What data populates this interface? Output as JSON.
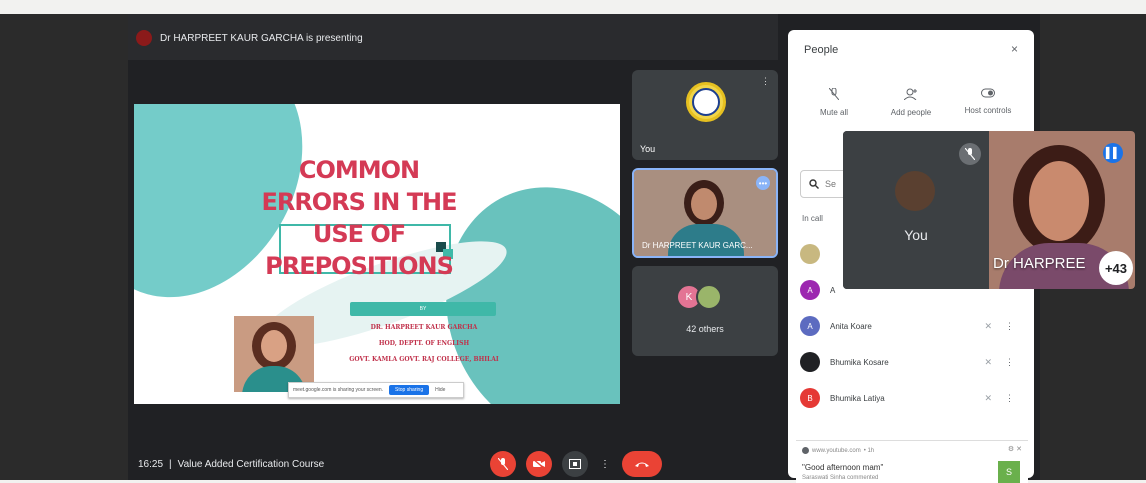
{
  "presenter": {
    "avatar_initial": "",
    "text": "Dr HARPREET KAUR GARCHA is presenting"
  },
  "slide": {
    "title": "COMMON ERRORS IN THE USE OF PREPOSITIONS",
    "band_text": "BY",
    "lines": [
      "DR. HARPREET KAUR GARCHA",
      "HOD, DEPTT. OF ENGLISH",
      "GOVT. KAMLA GOVT. RAJ COLLEGE, BHILAI"
    ],
    "share_notice": "meet.google.com is sharing your screen.",
    "share_stop": "Stop sharing",
    "share_hide": "Hide"
  },
  "tiles": {
    "you_label": "You",
    "harpreet_label": "Dr HARPREET KAUR GARC...",
    "others_label": "42 others",
    "others_initial": "K"
  },
  "bottom": {
    "time": "16:25",
    "separator": "|",
    "meeting_title": "Value Added Certification Course"
  },
  "people": {
    "title": "People",
    "close_icon": "×",
    "actions": [
      {
        "label": "Mute all",
        "icon": "mic-off-icon"
      },
      {
        "label": "Add people",
        "icon": "person-add-icon"
      },
      {
        "label": "Host controls",
        "icon": "toggle-icon"
      }
    ],
    "search_placeholder": "Se",
    "in_call_label": "In call",
    "participants": [
      {
        "name": "",
        "initial": "",
        "color": "#c8b880",
        "subtitle": ""
      },
      {
        "name": "A",
        "initial": "A",
        "color": "#9c27b0"
      },
      {
        "name": "Anita Koare",
        "initial": "A",
        "color": "#5c6bc0"
      },
      {
        "name": "Bhumika Kosare",
        "initial": "",
        "color": "#202124"
      },
      {
        "name": "Bhumika Latiya",
        "initial": "B",
        "color": "#e53935"
      }
    ],
    "notification": {
      "source": "www.youtube.com",
      "source_extra": "• 1h",
      "message": "\"Good afternoon mam\"",
      "by": "Saraswati Sinha commented",
      "avatar": "S"
    }
  },
  "pip": {
    "you_label": "You",
    "speaker_name": "Dr HARPREE",
    "count": "+43"
  },
  "colors": {
    "meet_bg": "#202124",
    "tile_bg": "#3c4043",
    "end_call": "#ea4335",
    "accent": "#1a73e8",
    "slide_title": "#d43a55",
    "slide_teal": "#3fb8a8"
  }
}
